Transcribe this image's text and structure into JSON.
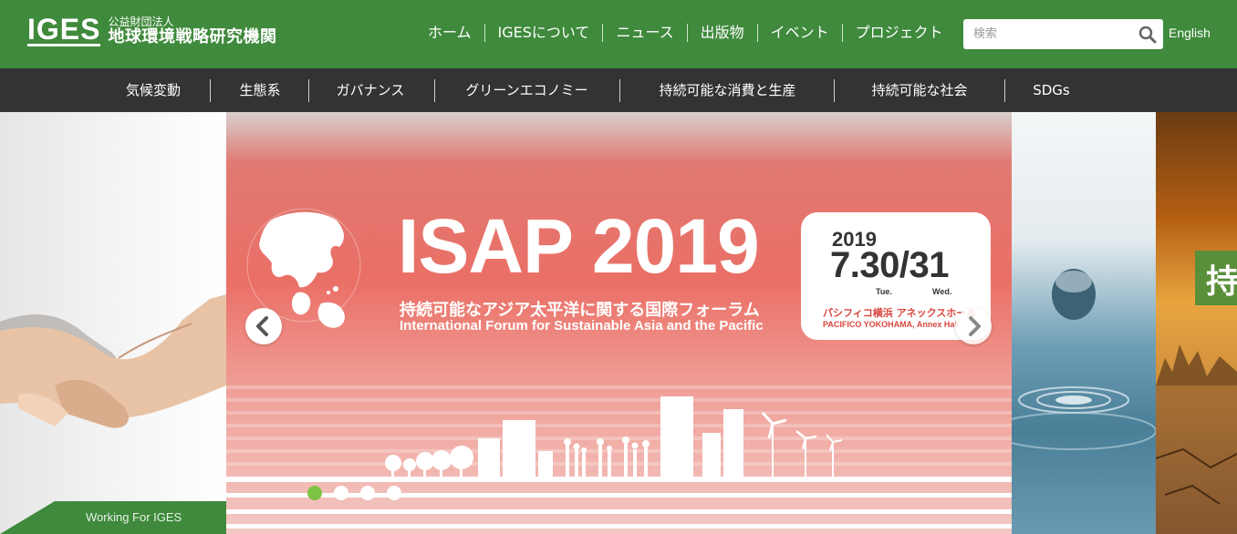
{
  "header": {
    "logo_mark": "IGES",
    "logo_sub": "公益財団法人",
    "logo_main": "地球環境戦略研究機関",
    "nav": [
      {
        "label": "ホーム"
      },
      {
        "label": "IGESについて"
      },
      {
        "label": "ニュース"
      },
      {
        "label": "出版物"
      },
      {
        "label": "イベント"
      },
      {
        "label": "プロジェクト"
      }
    ],
    "search_placeholder": "検索",
    "search_icon": "search-icon",
    "language": "English",
    "bg_color": "#3f8a3c"
  },
  "categories": [
    {
      "label": "気候変動"
    },
    {
      "label": "生態系"
    },
    {
      "label": "ガバナンス"
    },
    {
      "label": "グリーンエコノミー"
    },
    {
      "label": "持続可能な消費と生産"
    },
    {
      "label": "持続可能な社会"
    },
    {
      "label": "SDGs"
    }
  ],
  "hero": {
    "left_panel_label": "Working For IGES",
    "slide": {
      "title": "ISAP 2019",
      "subtitle_jp": "持続可能なアジア太平洋に関する国際フォーラム",
      "subtitle_en": "International Forum for Sustainable Asia and the Pacific",
      "year": "2019",
      "dates": "7.30/31",
      "day1": "Tue.",
      "day2": "Wed.",
      "venue_jp": "パシフィコ横浜 アネックスホール",
      "venue_en": "PACIFICO YOKOHAMA, Annex Hall"
    },
    "prev_icon": "chevron-left-icon",
    "next_icon": "chevron-right-icon",
    "dots_count": 4,
    "active_dot": 0,
    "right_panel_char": "持",
    "accent_dot_color": "#7cc243"
  }
}
